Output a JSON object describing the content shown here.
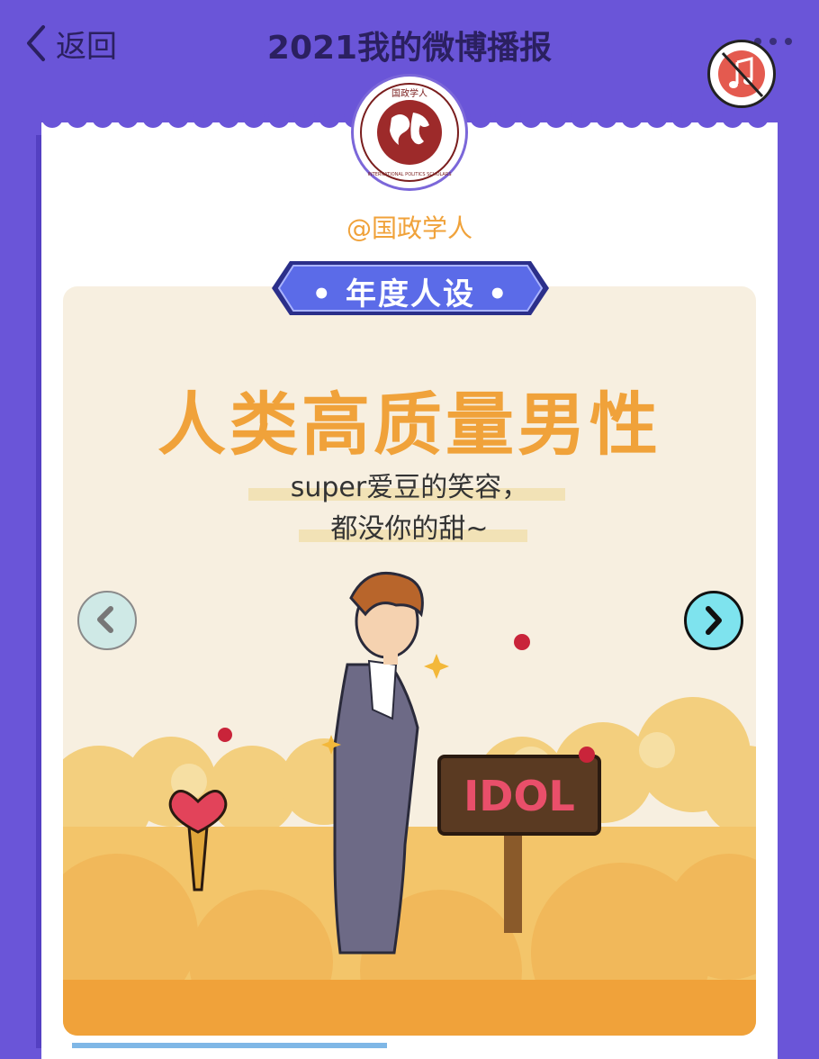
{
  "header": {
    "back_label": "返回",
    "title": "2021我的微博播报"
  },
  "profile": {
    "avatar_text": "国政学人",
    "avatar_ring_text": "INTERNATIONAL POLITICS SCHOLARS",
    "username": "@国政学人"
  },
  "badge": {
    "label": "• 年度人设 •"
  },
  "content": {
    "headline": "人类高质量男性",
    "subtitle_line1": "super爱豆的笑容，",
    "subtitle_line2": "都没你的甜~",
    "sign_text": "IDOL"
  },
  "icons": {
    "back": "chevron-left-icon",
    "more": "more-dots-icon",
    "music": "music-muted-icon",
    "prev": "chevron-left-icon",
    "next": "chevron-right-icon"
  },
  "colors": {
    "background": "#6a55d8",
    "accent_orange": "#f0a23a",
    "badge_blue": "#5b6be8",
    "panel_bg": "#f7efe0"
  }
}
